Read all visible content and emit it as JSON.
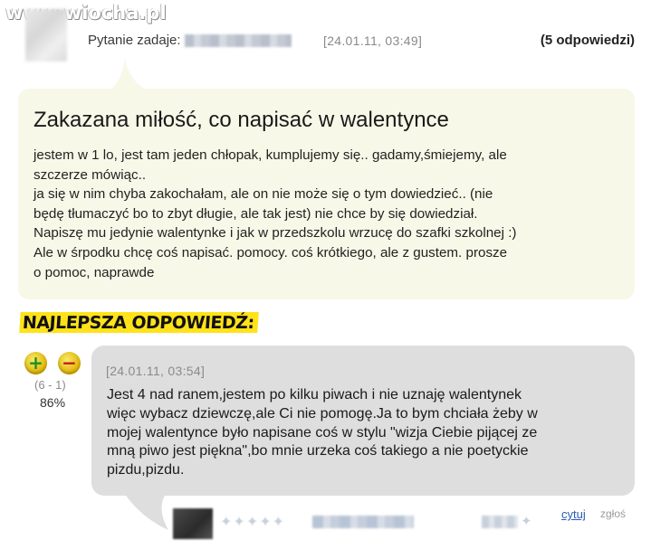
{
  "watermark": "www.wiocha.pl",
  "question": {
    "asker_label": "Pytanie zadaje:",
    "date": "[24.01.11, 03:49]",
    "answers_count": "(5 odpowiedzi)",
    "title": "Zakazana miłość, co napisać w walentynce",
    "body_lines": [
      "jestem w 1 lo, jest tam jeden chłopak, kumplujemy się.. gadamy,śmiejemy, ale",
      "szczerze mówiąc..",
      "ja się w nim chyba zakochałam, ale on nie może się o tym dowiedzieć.. (nie",
      "będę tłumaczyć bo to zbyt długie, ale tak jest) nie chce by się dowiedział.",
      "Napiszę mu jedynie walentynke i jak w przedszkolu wrzucę do szafki szkolnej :)",
      "Ale w śrpodku chcę coś napisać. pomocy. coś krótkiego, ale z gustem. prosze",
      "o pomoc, naprawde"
    ]
  },
  "best_answer": {
    "label": "NAJLEPSZA ODPOWIEDŹ:",
    "votes": {
      "plus": "+",
      "minus": "−",
      "counts": "(6 - 1)",
      "percent": "86%"
    },
    "date": "[24.01.11, 03:54]",
    "body_lines": [
      "Jest 4 nad ranem,jestem po kilku piwach i nie uznaję walentynek",
      "więc wybacz dziewczę,ale Ci nie pomogę.Ja to bym chciała żeby w",
      "mojej walentynce było napisane coś w stylu \"wizja Ciebie pijącej ze",
      "mną piwo jest piękna\",bo mnie urzeka coś takiego a nie poetyckie",
      "pizdu,pizdu."
    ],
    "footer": {
      "stars": "✦✦✦✦✦",
      "star_single": "✦",
      "cite": "cytuj",
      "report": "zgłoś"
    }
  },
  "colors": {
    "question_bubble": "#f8f8e8",
    "answer_bubble": "#dedede",
    "highlight": "#ffe21a",
    "link": "#2a5db0"
  }
}
